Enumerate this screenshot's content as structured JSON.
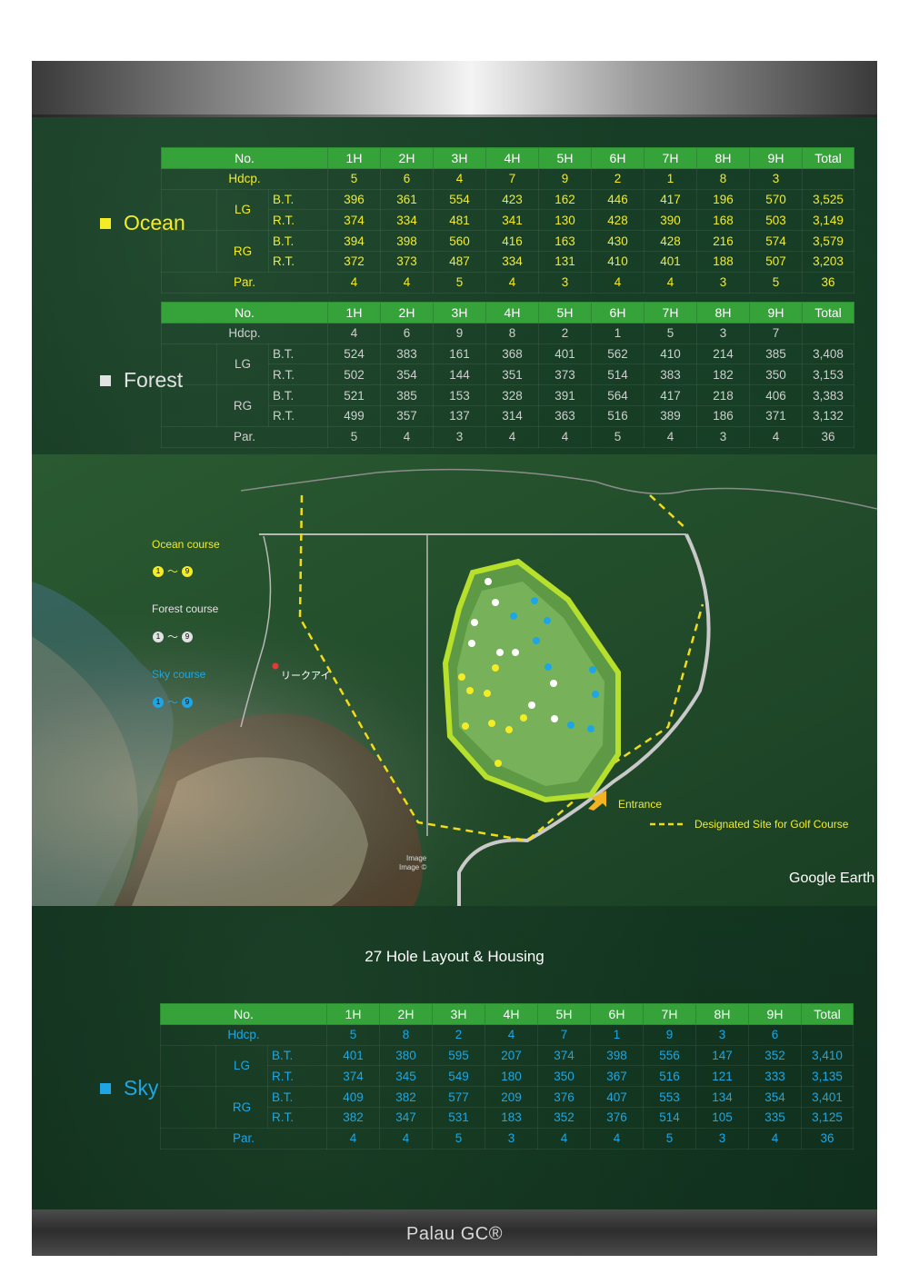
{
  "colors": {
    "ocean": "#f4ec24",
    "forest": "#e2e2e2",
    "sky": "#1ea6e4",
    "header": "#35a23a",
    "route": "#f0dc1a"
  },
  "footer": "Palau GC®",
  "map_title": "27 Hole Layout & Housing",
  "scorecards": {
    "ocean": {
      "name": "Ocean",
      "header": [
        "No.",
        "1H",
        "2H",
        "3H",
        "4H",
        "5H",
        "6H",
        "7H",
        "8H",
        "9H",
        "Total"
      ],
      "hdcp": {
        "label": "Hdcp.",
        "values": [
          "5",
          "6",
          "4",
          "7",
          "9",
          "2",
          "1",
          "8",
          "3",
          ""
        ]
      },
      "lg": {
        "label": "LG",
        "bt": {
          "label": "B.T.",
          "values": [
            "396",
            "361",
            "554",
            "423",
            "162",
            "446",
            "417",
            "196",
            "570",
            "3,525"
          ]
        },
        "rt": {
          "label": "R.T.",
          "values": [
            "374",
            "334",
            "481",
            "341",
            "130",
            "428",
            "390",
            "168",
            "503",
            "3,149"
          ]
        }
      },
      "rg": {
        "label": "RG",
        "bt": {
          "label": "B.T.",
          "values": [
            "394",
            "398",
            "560",
            "416",
            "163",
            "430",
            "428",
            "216",
            "574",
            "3,579"
          ]
        },
        "rt": {
          "label": "R.T.",
          "values": [
            "372",
            "373",
            "487",
            "334",
            "131",
            "410",
            "401",
            "188",
            "507",
            "3,203"
          ]
        }
      },
      "par": {
        "label": "Par.",
        "values": [
          "4",
          "4",
          "5",
          "4",
          "3",
          "4",
          "4",
          "3",
          "5",
          "36"
        ]
      }
    },
    "forest": {
      "name": "Forest",
      "header": [
        "No.",
        "1H",
        "2H",
        "3H",
        "4H",
        "5H",
        "6H",
        "7H",
        "8H",
        "9H",
        "Total"
      ],
      "hdcp": {
        "label": "Hdcp.",
        "values": [
          "4",
          "6",
          "9",
          "8",
          "2",
          "1",
          "5",
          "3",
          "7",
          ""
        ]
      },
      "lg": {
        "label": "LG",
        "bt": {
          "label": "B.T.",
          "values": [
            "524",
            "383",
            "161",
            "368",
            "401",
            "562",
            "410",
            "214",
            "385",
            "3,408"
          ]
        },
        "rt": {
          "label": "R.T.",
          "values": [
            "502",
            "354",
            "144",
            "351",
            "373",
            "514",
            "383",
            "182",
            "350",
            "3,153"
          ]
        }
      },
      "rg": {
        "label": "RG",
        "bt": {
          "label": "B.T.",
          "values": [
            "521",
            "385",
            "153",
            "328",
            "391",
            "564",
            "417",
            "218",
            "406",
            "3,383"
          ]
        },
        "rt": {
          "label": "R.T.",
          "values": [
            "499",
            "357",
            "137",
            "314",
            "363",
            "516",
            "389",
            "186",
            "371",
            "3,132"
          ]
        }
      },
      "par": {
        "label": "Par.",
        "values": [
          "5",
          "4",
          "3",
          "4",
          "4",
          "5",
          "4",
          "3",
          "4",
          "36"
        ]
      }
    },
    "sky": {
      "name": "Sky",
      "header": [
        "No.",
        "1H",
        "2H",
        "3H",
        "4H",
        "5H",
        "6H",
        "7H",
        "8H",
        "9H",
        "Total"
      ],
      "hdcp": {
        "label": "Hdcp.",
        "values": [
          "5",
          "8",
          "2",
          "4",
          "7",
          "1",
          "9",
          "3",
          "6",
          ""
        ]
      },
      "lg": {
        "label": "LG",
        "bt": {
          "label": "B.T.",
          "values": [
            "401",
            "380",
            "595",
            "207",
            "374",
            "398",
            "556",
            "147",
            "352",
            "3,410"
          ]
        },
        "rt": {
          "label": "R.T.",
          "values": [
            "374",
            "345",
            "549",
            "180",
            "350",
            "367",
            "516",
            "121",
            "333",
            "3,135"
          ]
        }
      },
      "rg": {
        "label": "RG",
        "bt": {
          "label": "B.T.",
          "values": [
            "409",
            "382",
            "577",
            "209",
            "376",
            "407",
            "553",
            "134",
            "354",
            "3,401"
          ]
        },
        "rt": {
          "label": "R.T.",
          "values": [
            "382",
            "347",
            "531",
            "183",
            "352",
            "376",
            "514",
            "105",
            "335",
            "3,125"
          ]
        }
      },
      "par": {
        "label": "Par.",
        "values": [
          "4",
          "4",
          "5",
          "3",
          "4",
          "4",
          "5",
          "3",
          "4",
          "36"
        ]
      }
    }
  },
  "map": {
    "legend": {
      "ocean": {
        "label": "Ocean course",
        "range_start": "1",
        "sep": "～",
        "range_end": "9"
      },
      "forest": {
        "label": "Forest course",
        "range_start": "1",
        "sep": "～",
        "range_end": "9"
      },
      "sky": {
        "label": "Sky course",
        "range_start": "1",
        "sep": "～",
        "range_end": "9"
      }
    },
    "entrance_label": "Entrance",
    "designated_label": "Designated Site for Golf Course",
    "pin_label": "リークアイ",
    "watermark": "Google Earth",
    "image_credit": [
      "Image",
      "Image ©"
    ]
  }
}
